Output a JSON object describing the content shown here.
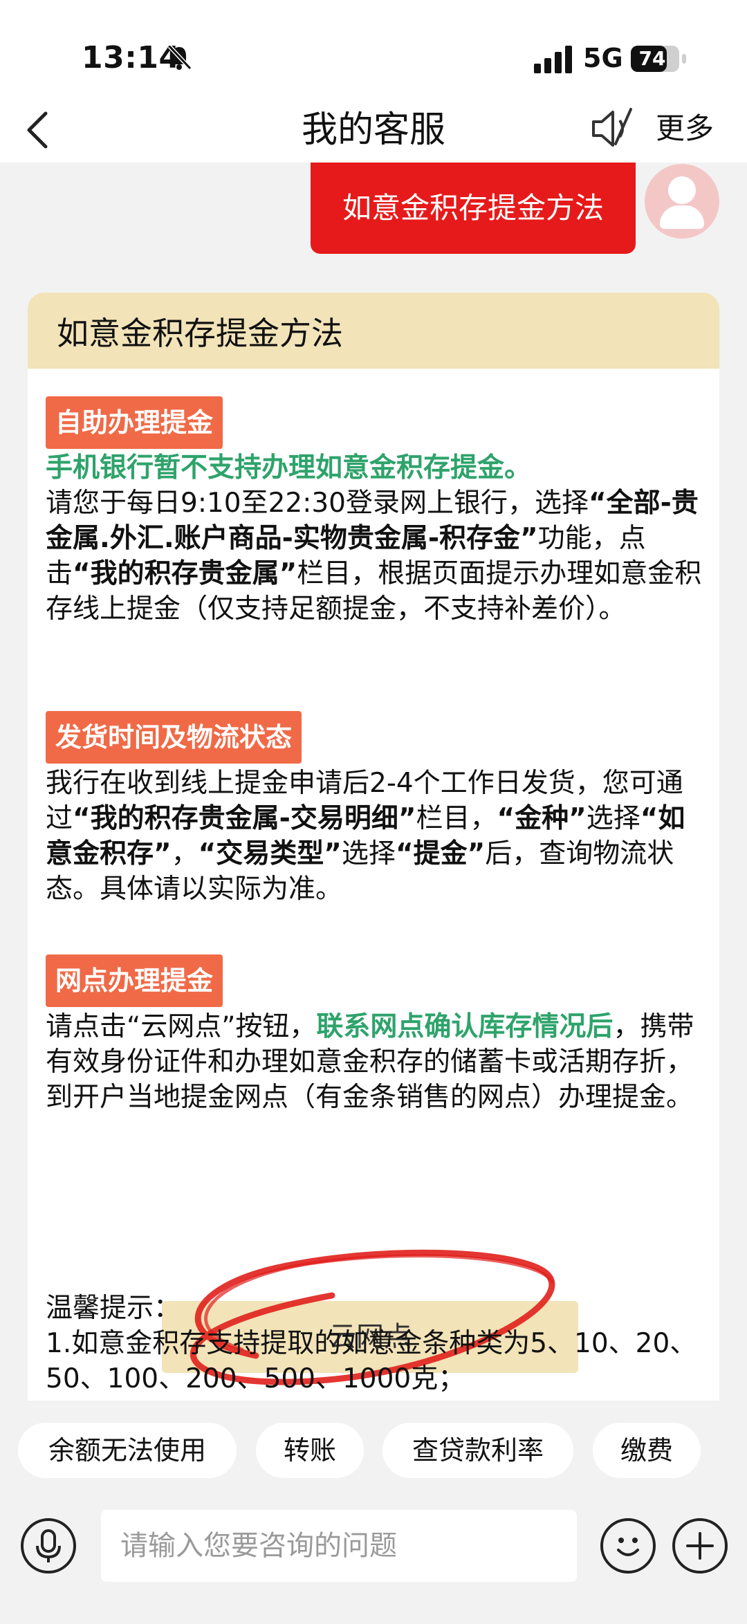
{
  "status": {
    "time": "13:14",
    "network": "5G",
    "battery": "74",
    "battery_level": 0.74
  },
  "nav": {
    "title": "我的客服",
    "more": "更多"
  },
  "user_message": "如意金积存提金方法",
  "card": {
    "title": "如意金积存提金方法",
    "s1": {
      "tag": "自助办理提金",
      "green": "手机银行暂不支持办理如意金积存提金。",
      "t1": "请您于每日9:10至22:30登录网上银行，选择",
      "b1": "“全部-贵金属.外汇.账户商品-实物贵金属-积存金”",
      "t2": "功能，点击",
      "b2": "“我的积存贵金属”",
      "t3": "栏目，根据页面提示办理如意金积存线上提金（仅支持足额提金，不支持补差价）。"
    },
    "s2": {
      "tag": "发货时间及物流状态",
      "t1": "我行在收到线上提金申请后2-4个工作日发货，您可通过",
      "b1": "“我的积存贵金属-交易明细”",
      "t2": "栏目，",
      "b2": "“金种”",
      "t3": "选择",
      "b3": "“如意金积存”",
      "t4": "，",
      "b4": "“交易类型”",
      "t5": "选择",
      "b5": "“提金”",
      "t6": "后，查询物流状态。具体请以实际为准。"
    },
    "s3": {
      "tag": "网点办理提金",
      "t1": "请点击“云网点”按钮，",
      "green": "联系网点确认库存情况后",
      "t2": "，携带有效身份证件和办理如意金积存的储蓄卡或活期存折，到开户当地提金网点（有金条销售的网点）办理提金。"
    },
    "button": "云网点",
    "tips_title": "温馨提示：",
    "tips_1": "1.如意金积存支持提取的如意金条种类为5、10、20、50、100、200、500、1000克；"
  },
  "suggestions": [
    "余额无法使用",
    "转账",
    "查贷款利率",
    "缴费"
  ],
  "input_placeholder": "请输入您要咨询的问题"
}
